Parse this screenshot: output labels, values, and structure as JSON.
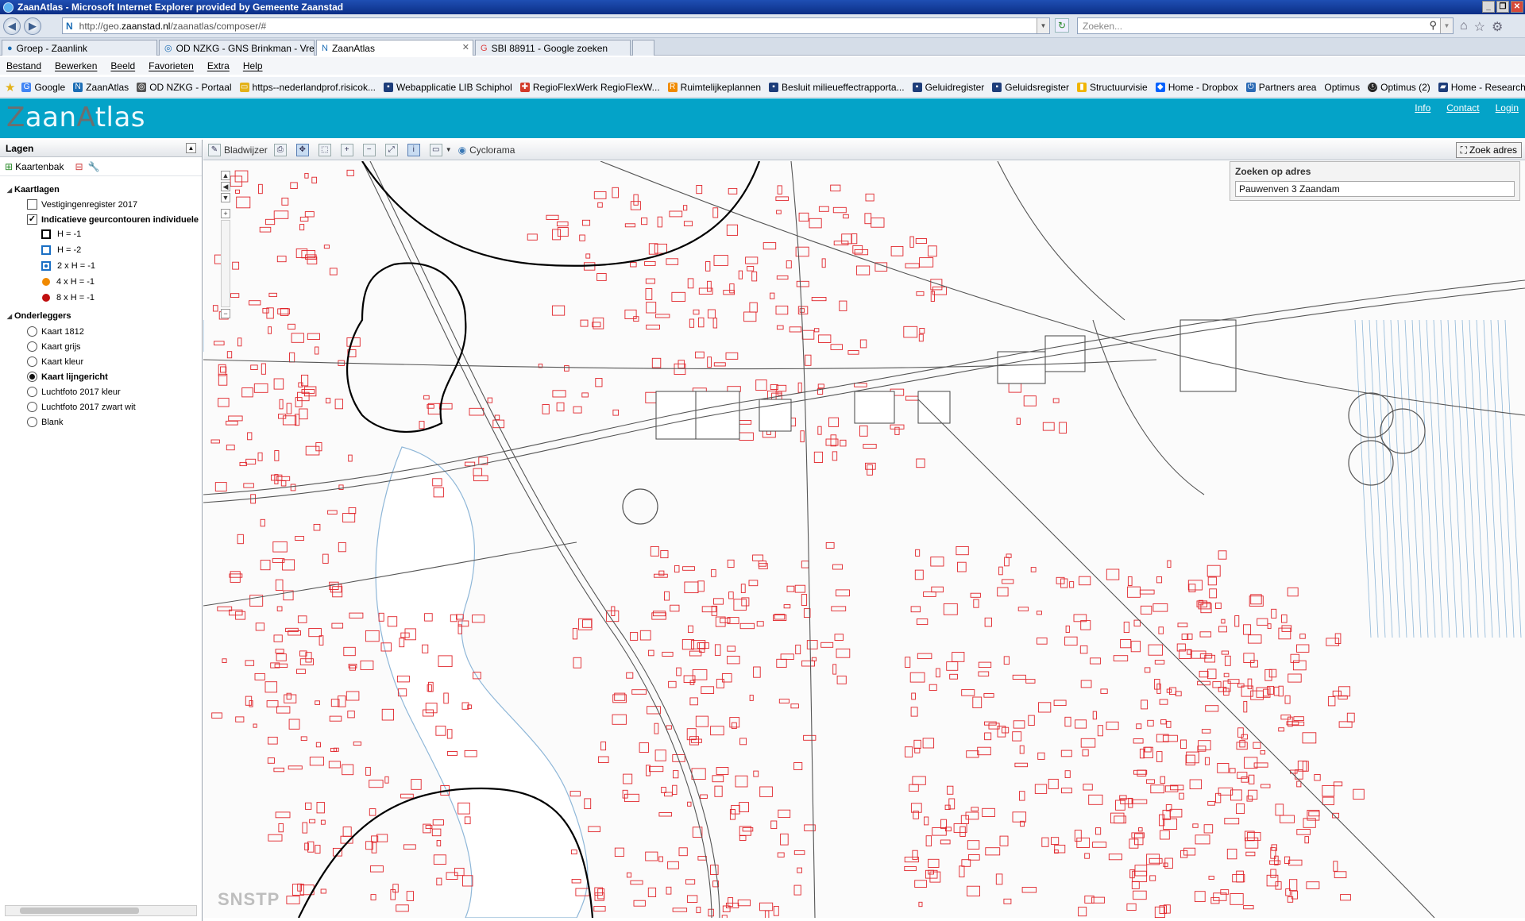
{
  "window": {
    "title": "ZaanAtlas - Microsoft Internet Explorer provided by Gemeente Zaanstad"
  },
  "browser": {
    "url_prefix": "http://geo.",
    "url_domain": "zaanstad.nl",
    "url_path": "/zaanatlas/composer/#",
    "search_placeholder": "Zoeken...",
    "tabs": [
      {
        "label": "Groep - Zaanlink",
        "active": false
      },
      {
        "label": "OD NZKG - GNS Brinkman - Vred...",
        "active": false
      },
      {
        "label": "ZaanAtlas",
        "active": true
      },
      {
        "label": "SBI 88911 - Google zoeken",
        "active": false
      }
    ],
    "menu": [
      "Bestand",
      "Bewerken",
      "Beeld",
      "Favorieten",
      "Extra",
      "Help"
    ],
    "favorites": [
      "Google",
      "ZaanAtlas",
      "OD NZKG - Portaal",
      "https--nederlandprof.risicok...",
      "Webapplicatie LIB Schiphol",
      "RegioFlexWerk RegioFlexW...",
      "Ruimtelijkeplannen",
      "Besluit milieueffectrapporta...",
      "Geluidregister",
      "Geluidsregister",
      "Structuurvisie",
      "Home - Dropbox",
      "Partners area",
      "Optimus",
      "Optimus (2)",
      "Home - Research Participan..."
    ]
  },
  "app": {
    "logo": {
      "part1": "Z",
      "part2": "aan",
      "part3": "A",
      "part4": "tlas"
    },
    "links": [
      "Info",
      "Contact",
      "Login"
    ]
  },
  "sidebar": {
    "title": "Lagen",
    "tool_label": "Kaartenbak",
    "groups": {
      "kaartlagen": "Kaartlagen",
      "onderleggers": "Onderleggers"
    },
    "layers": [
      {
        "label": "Vestigingenregister 2017",
        "checked": false
      },
      {
        "label": "Indicatieve geurcontouren individuele",
        "checked": true
      }
    ],
    "legend": [
      {
        "label": "H = -1",
        "color": "#000000",
        "shape": "square"
      },
      {
        "label": "H = -2",
        "color": "#1a6fc4",
        "shape": "square"
      },
      {
        "label": "2 x H = -1",
        "color": "#1a6fc4",
        "shape": "filled-square"
      },
      {
        "label": "4 x H = -1",
        "color": "#f08a00",
        "shape": "circle"
      },
      {
        "label": "8 x H = -1",
        "color": "#c01010",
        "shape": "circle"
      }
    ],
    "basemaps": [
      {
        "label": "Kaart 1812",
        "selected": false
      },
      {
        "label": "Kaart grijs",
        "selected": false
      },
      {
        "label": "Kaart kleur",
        "selected": false
      },
      {
        "label": "Kaart lijngericht",
        "selected": true
      },
      {
        "label": "Luchtfoto 2017 kleur",
        "selected": false
      },
      {
        "label": "Luchtfoto 2017 zwart wit",
        "selected": false
      },
      {
        "label": "Blank",
        "selected": false
      }
    ]
  },
  "toolbar": {
    "bookmark": "Bladwijzer",
    "cyclorama": "Cyclorama",
    "zoek_adres": "Zoek adres"
  },
  "search_panel": {
    "title": "Zoeken op adres",
    "value": "Pauwenven 3 Zaandam"
  },
  "map": {
    "watermark": "SNSTP",
    "colors": {
      "buildings": "#e0242a",
      "roads": "#555555",
      "water": "#8fb7d8",
      "contour": "#000000"
    }
  }
}
